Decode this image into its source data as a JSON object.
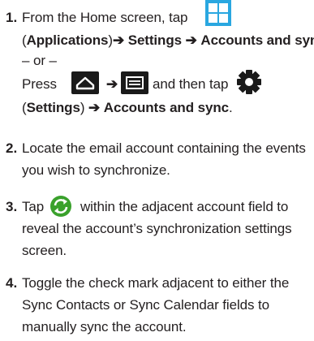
{
  "steps": [
    {
      "number": "1.",
      "line1_prefix": "From the Home screen, tap",
      "line2_open": "(",
      "line2_app": "Applications",
      "line2_close": ")",
      "arrow": "➔",
      "line2_settings": "Settings",
      "line2_accounts": "Accounts and sync",
      "line2_period": ".",
      "or_text": "– or –",
      "press_text": "Press",
      "then_tap_text": "and then tap",
      "line5_open": "(",
      "line5_settings": "Settings",
      "line5_close": ")",
      "line5_accounts": "Accounts and sync",
      "line5_period": "."
    },
    {
      "number": "2.",
      "line1": "Locate the email account containing the events",
      "line2": "you wish to synchronize."
    },
    {
      "number": "3.",
      "tap_text": "Tap",
      "line1_rest": "within the adjacent account field to",
      "line2": "reveal the account’s synchronization settings",
      "line3": "screen."
    },
    {
      "number": "4.",
      "line1": "Toggle the check mark adjacent to either the",
      "line2": "Sync Contacts or Sync Calendar fields to",
      "line3": "manually sync the account."
    }
  ],
  "icons": {
    "applications": "applications-grid-icon",
    "home": "home-key-icon",
    "menu": "menu-key-icon",
    "settings": "settings-gear-icon",
    "sync": "sync-icon"
  },
  "colors": {
    "text": "#231f20",
    "app_icon": "#2aa7e0",
    "key_icon": "#1a1a1a",
    "sync_icon": "#3aa12c"
  }
}
